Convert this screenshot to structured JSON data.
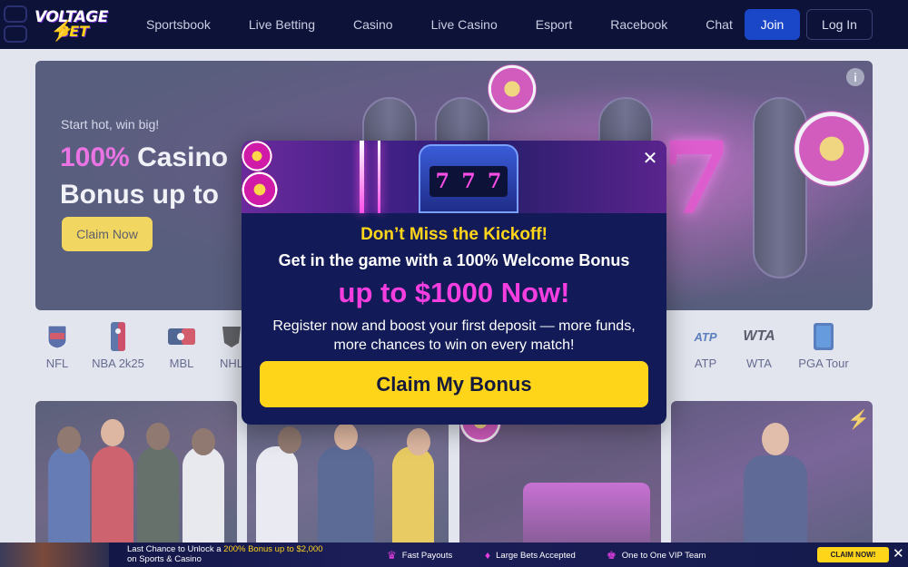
{
  "header": {
    "logo_line1": "VOLTAGE",
    "logo_line2": "BET",
    "nav": [
      "Sportsbook",
      "Live Betting",
      "Casino",
      "Live Casino",
      "Esport",
      "Racebook",
      "Chat"
    ],
    "join_label": "Join",
    "login_label": "Log In"
  },
  "hero": {
    "kicker": "Start hot, win big!",
    "title_highlight": "100%",
    "title_rest1": " Casino",
    "title_line2": "Bonus up to",
    "claim_label": "Claim Now",
    "info_symbol": "i"
  },
  "sports": [
    "NFL",
    "NBA 2k25",
    "MBL",
    "NHL",
    "ATP",
    "WTA",
    "PGA Tour"
  ],
  "modal": {
    "close_symbol": "✕",
    "headline": "Don’t Miss the Kickoff!",
    "subheadline": "Get in the game with a 100% Welcome Bonus",
    "amount": "up to $1000 Now!",
    "body_line1": "Register now and boost your first deposit — more funds,",
    "body_line2": "more chances to win on every match!",
    "cta_label": "Claim My Bonus"
  },
  "promo_bar": {
    "text_prefix": "Last Chance to Unlock a ",
    "text_highlight": "200% Bonus up to $2,000",
    "text_line2": "on Sports & Casino",
    "features": [
      "Fast Payouts",
      "Large Bets Accepted",
      "One to One VIP Team"
    ],
    "claim_label": "CLAIM NOW!",
    "close_symbol": "✕"
  },
  "colors": {
    "header_bg": "#0d1238",
    "accent_yellow": "#ffd51a",
    "accent_pink": "#f43ee0",
    "join_blue": "#1a46c8",
    "modal_bg": "#121b57"
  }
}
